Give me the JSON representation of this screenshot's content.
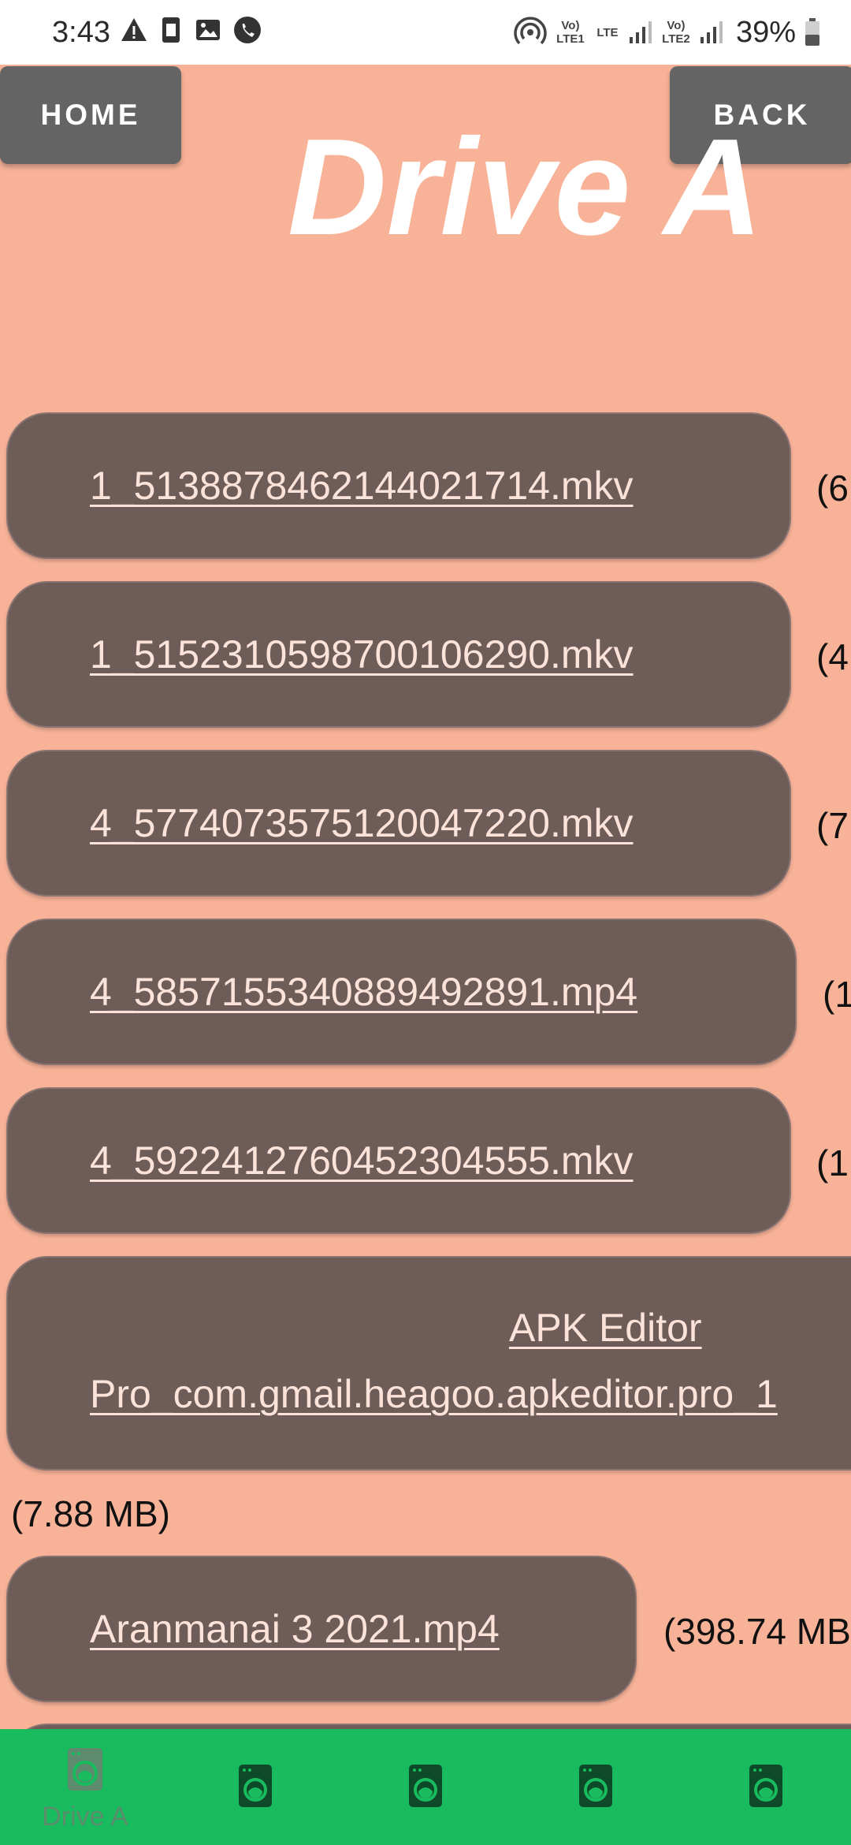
{
  "status_bar": {
    "time": "3:43",
    "sim1_label": "Vo) LTE1",
    "net_label": "LTE",
    "sim2_label": "Vo) LTE2",
    "battery": "39%",
    "icons": [
      "warning-icon",
      "sim-icon",
      "image-icon",
      "phone-icon",
      "hotspot-icon",
      "signal-icon",
      "battery-icon"
    ]
  },
  "header": {
    "home_label": "HOME",
    "back_label": "BACK",
    "title": "Drive A"
  },
  "files": [
    {
      "name": "1_5138878462144021714.mkv",
      "size": "(6"
    },
    {
      "name": "1_5152310598700106290.mkv",
      "size": "(4"
    },
    {
      "name": "4_5774073575120047220.mkv",
      "size": "(7"
    },
    {
      "name": "4_5857155340889492891.mp4",
      "size": "(1"
    },
    {
      "name": "4_5922412760452304555.mkv",
      "size": "(1"
    },
    {
      "name_line1": "APK Editor",
      "name_line2": "Pro_com.gmail.heagoo.apkeditor.pro_1",
      "size": "(7.88 MB)"
    },
    {
      "name": "Aranmanai 3 2021.mp4",
      "size": "(398.74 MB"
    }
  ],
  "bottom_nav": {
    "items": [
      {
        "label": "Drive A",
        "active": true
      },
      {
        "label": ""
      },
      {
        "label": ""
      },
      {
        "label": ""
      },
      {
        "label": ""
      }
    ]
  },
  "colors": {
    "background": "#f7b298",
    "button": "#6e5c59",
    "header_button": "#646464",
    "nav": "#18bc5e"
  }
}
